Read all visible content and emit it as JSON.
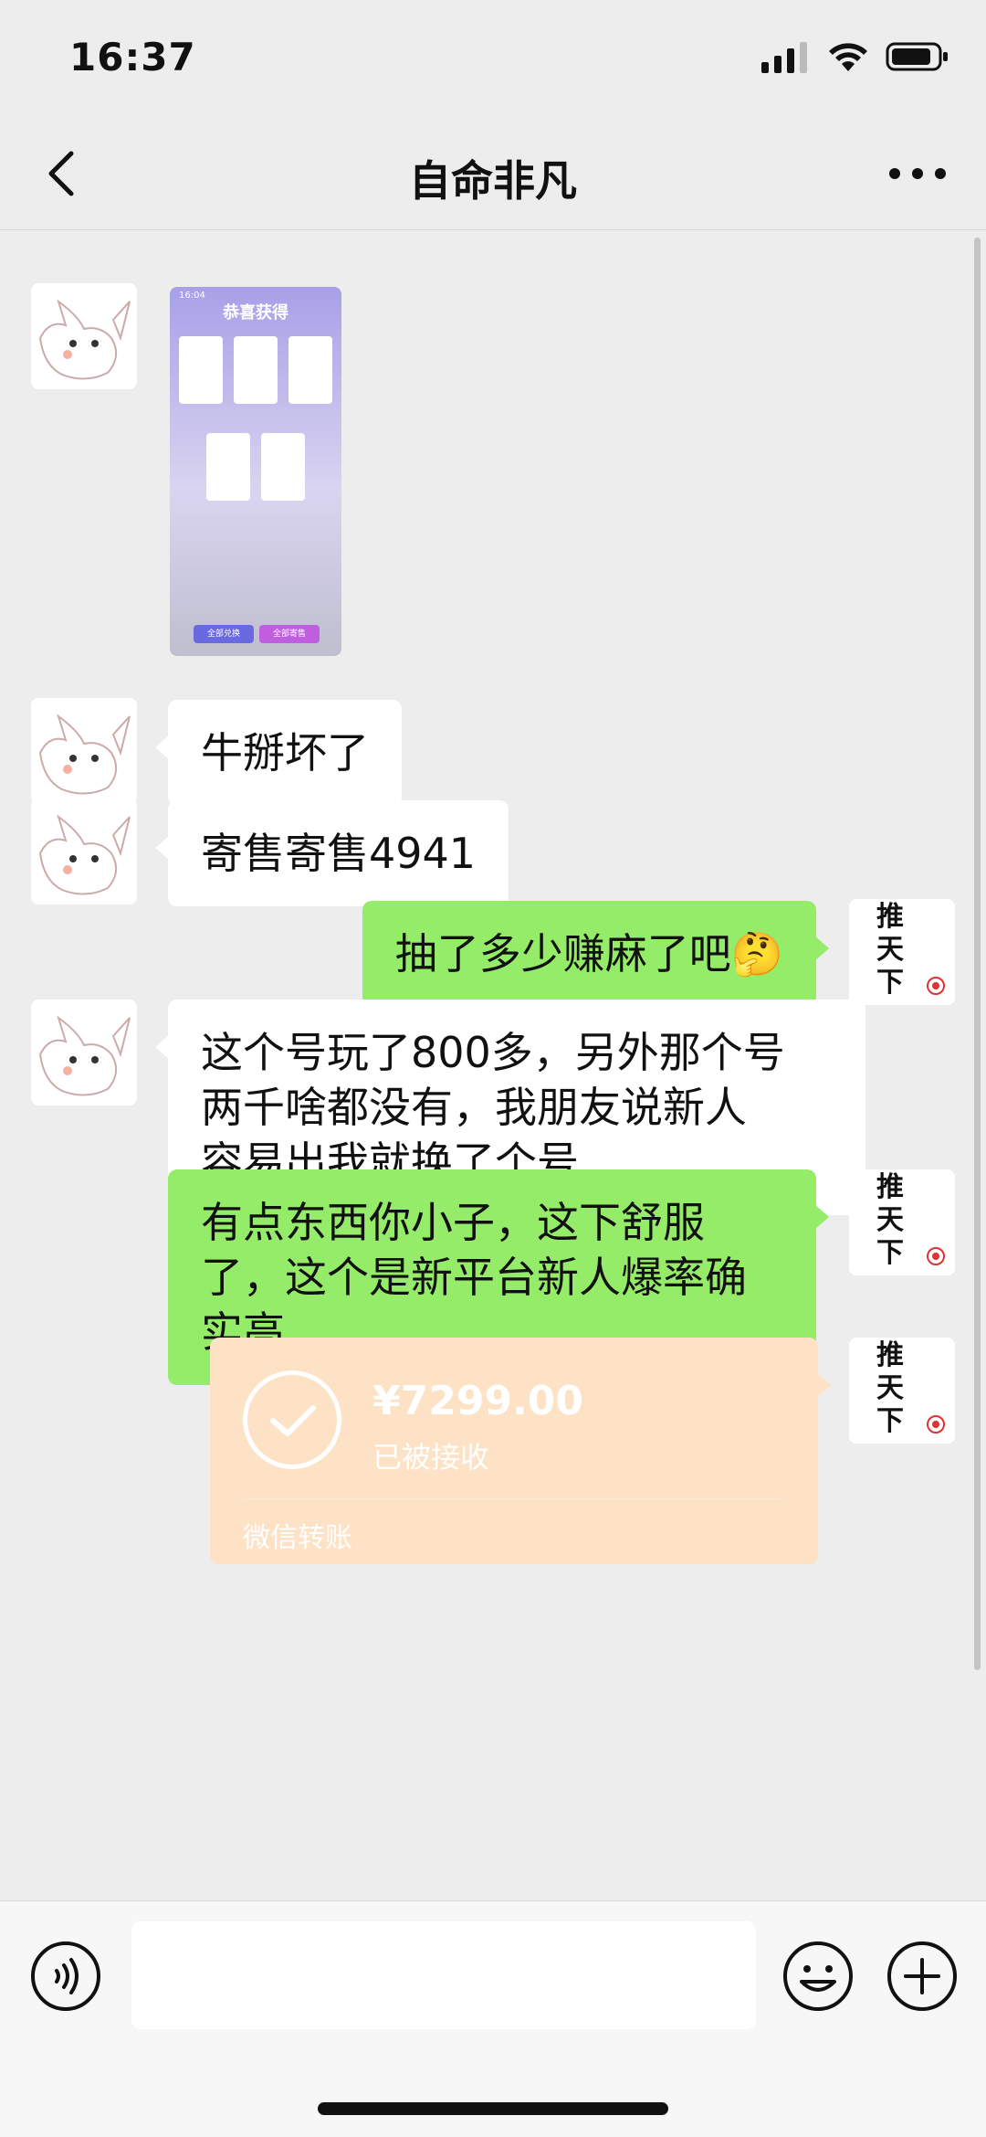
{
  "status": {
    "time": "16:37"
  },
  "header": {
    "title": "自命非凡"
  },
  "thumbnail": {
    "title": "恭喜获得",
    "time": "16:04",
    "btn_left": "全部兑换",
    "btn_right": "全部寄售"
  },
  "messages": [
    {
      "side": "in",
      "type": "image"
    },
    {
      "side": "in",
      "text": "牛掰坏了"
    },
    {
      "side": "in",
      "text": "寄售寄售4941"
    },
    {
      "side": "out",
      "text": "抽了多少赚麻了吧🤔"
    },
    {
      "side": "in",
      "lines": [
        "这个号玩了800多，另外那个号",
        "两千啥都没有，我朋友说新人",
        "容易出我就换了个号"
      ]
    },
    {
      "side": "out",
      "lines": [
        "有点东西你小子，这下舒服",
        "了，这个是新平台新人爆率确",
        "实高"
      ]
    }
  ],
  "transfer": {
    "amount": "¥7299.00",
    "status": "已被接收",
    "label": "微信转账"
  },
  "avatar_right": {
    "text": [
      "推",
      "天",
      "下"
    ]
  },
  "colors": {
    "out_bubble": "#95ec69",
    "in_bubble": "#ffffff",
    "transfer": "#fde2c6",
    "background": "#ededed"
  },
  "icons": [
    "back-icon",
    "more-icon",
    "signal-icon",
    "wifi-icon",
    "battery-icon",
    "voice-icon",
    "emoji-icon",
    "plus-icon",
    "check-icon"
  ]
}
